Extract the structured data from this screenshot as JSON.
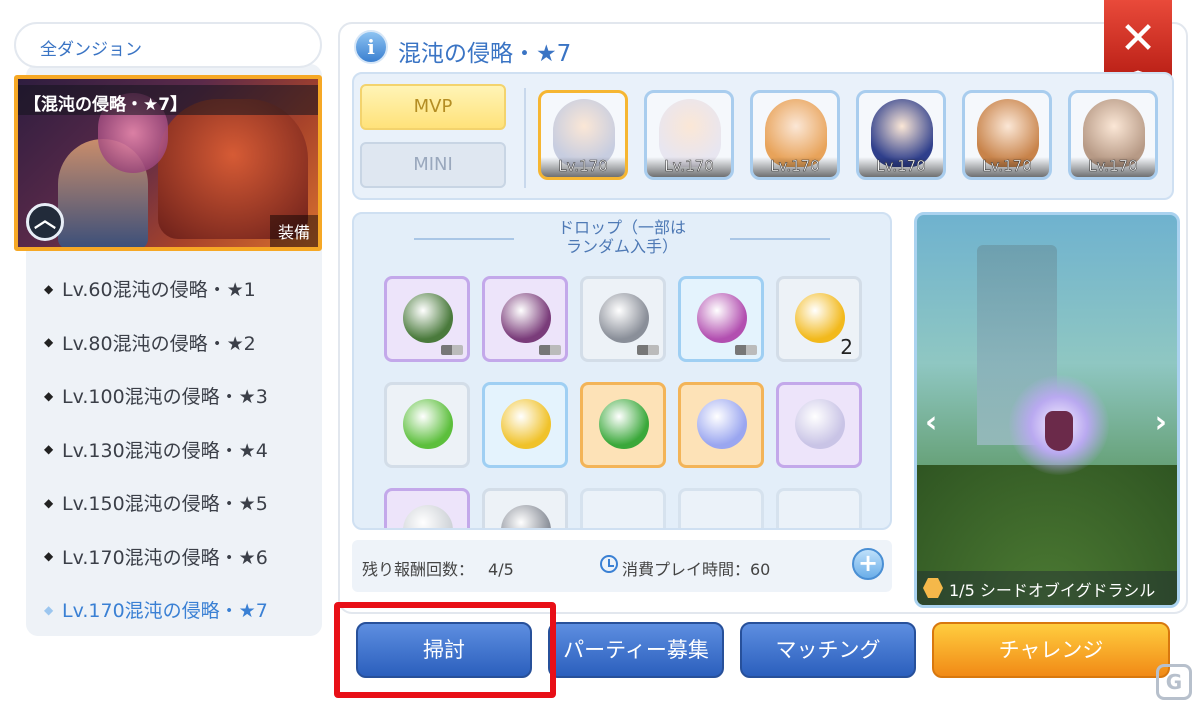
{
  "sidebar": {
    "all_dungeon_label": "全ダンジョン",
    "card": {
      "title": "【混沌の侵略・★7】",
      "equip_label": "装備",
      "collapse_icon": "chevron-up-icon"
    },
    "levels": [
      "Lv.60混沌の侵略・★1",
      "Lv.80混沌の侵略・★2",
      "Lv.100混沌の侵略・★3",
      "Lv.130混沌の侵略・★4",
      "Lv.150混沌の侵略・★5",
      "Lv.170混沌の侵略・★6",
      "Lv.170混沌の侵略・★7"
    ],
    "active_index": 6
  },
  "header": {
    "info_icon": "i",
    "title": "混沌の侵略・★7",
    "close_icon": "✕"
  },
  "boss_tabs": {
    "mvp": "MVP",
    "mini": "MINI",
    "selected": "MVP"
  },
  "bosses": [
    {
      "level": "Lv.170",
      "color": "#c7cde0",
      "selected": true
    },
    {
      "level": "Lv.170",
      "color": "#e8e6f0",
      "selected": false
    },
    {
      "level": "Lv.170",
      "color": "#e8a35a",
      "selected": false
    },
    {
      "level": "Lv.170",
      "color": "#2f3f8c",
      "selected": false
    },
    {
      "level": "Lv.170",
      "color": "#c8834a",
      "selected": false
    },
    {
      "level": "Lv.170",
      "color": "#b79a86",
      "selected": false
    }
  ],
  "drops": {
    "header": "ドロップ（一部は\nランダム入手）",
    "header_line1": "ドロップ（一部は",
    "header_line2": "ランダム入手）",
    "items": [
      {
        "name": "whip-icon",
        "frame": "purple",
        "glyph": "ℓ",
        "color": "#4a7a3c",
        "badge": true
      },
      {
        "name": "staff-icon",
        "frame": "purple",
        "glyph": "╱",
        "color": "#7a3c7a",
        "badge": true
      },
      {
        "name": "wrench-icon",
        "frame": "gray",
        "glyph": "🔧",
        "color": "#8a8f99",
        "badge": true
      },
      {
        "name": "wand-icon",
        "frame": "blue",
        "glyph": "✦",
        "color": "#b24fb0",
        "badge": true
      },
      {
        "name": "coin-icon",
        "frame": "gray",
        "glyph": "●",
        "color": "#f2b91c",
        "count": "2"
      },
      {
        "name": "green-orb-icon",
        "frame": "gray",
        "glyph": "●",
        "color": "#5cbf3c"
      },
      {
        "name": "potion-vase-icon",
        "frame": "blue",
        "glyph": "⚱",
        "color": "#f0c22a"
      },
      {
        "name": "green-capsule-icon",
        "frame": "orange",
        "glyph": "▬",
        "color": "#3aa83a"
      },
      {
        "name": "wing-card-icon",
        "frame": "orange",
        "glyph": "❋",
        "color": "#9aa6f0"
      },
      {
        "name": "crystal-icon",
        "frame": "purple",
        "glyph": "◆",
        "color": "#c9c4e6"
      },
      {
        "name": "silver-crystal-icon",
        "frame": "purple",
        "glyph": "◆",
        "color": "#cfd3d8"
      },
      {
        "name": "z-coin-icon",
        "frame": "gray",
        "glyph": "Z",
        "color": "#8a8f99"
      },
      {
        "name": "empty-slot",
        "frame": "empty"
      },
      {
        "name": "empty-slot",
        "frame": "empty"
      },
      {
        "name": "empty-slot",
        "frame": "empty"
      }
    ]
  },
  "footer": {
    "remaining_label": "残り報酬回数：",
    "remaining_value": "4/5",
    "playtime_label": "消費プレイ時間：60"
  },
  "preview": {
    "caption": "1/5  シードオブイグドラシル",
    "left_arrow": "‹",
    "right_arrow": "›"
  },
  "actions": {
    "sweep": "掃討",
    "party": "パーティー募集",
    "matching": "マッチング",
    "challenge": "チャレンジ"
  },
  "colors": {
    "accent_blue": "#3a74c4",
    "highlight_red": "#e80f17",
    "close_red": "#d7362a",
    "challenge_orange": "#f39a1c"
  },
  "watermark": "G"
}
